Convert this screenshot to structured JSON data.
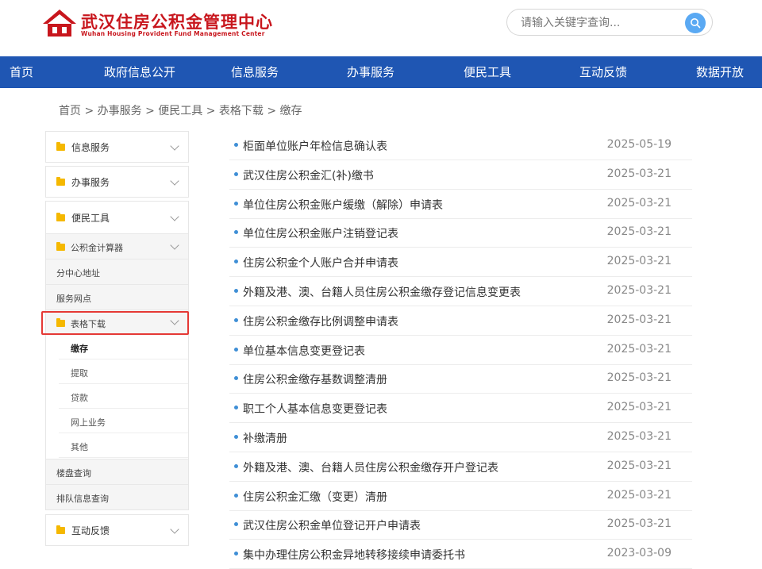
{
  "header": {
    "logo_cn": "武汉住房公积金管理中心",
    "logo_en": "Wuhan Housing Provident Fund Management Center",
    "search_placeholder": "请输入关键字查询...",
    "brand_color": "#c8161d"
  },
  "nav": {
    "color": "#1f56b3",
    "items": [
      "首页",
      "政府信息公开",
      "信息服务",
      "办事服务",
      "便民工具",
      "互动反馈",
      "数据开放"
    ]
  },
  "breadcrumb": "首页 > 办事服务 > 便民工具 > 表格下载 > 缴存",
  "sidebar": {
    "info": "信息服务",
    "service": "办事服务",
    "tools": "便民工具",
    "tools_sub": {
      "calculator": "公积金计算器",
      "branch": "分中心地址",
      "outlets": "服务网点",
      "forms": "表格下载",
      "forms_sub": [
        "缴存",
        "提取",
        "贷款",
        "网上业务",
        "其他"
      ],
      "property": "楼盘查询",
      "queue": "排队信息查询"
    },
    "feedback": "互动反馈"
  },
  "list": [
    {
      "title": "柜面单位账户年检信息确认表",
      "date": "2025-05-19"
    },
    {
      "title": "武汉住房公积金汇(补)缴书",
      "date": "2025-03-21"
    },
    {
      "title": "单位住房公积金账户缓缴（解除）申请表",
      "date": "2025-03-21"
    },
    {
      "title": "单位住房公积金账户注销登记表",
      "date": "2025-03-21"
    },
    {
      "title": "住房公积金个人账户合并申请表",
      "date": "2025-03-21"
    },
    {
      "title": "外籍及港、澳、台籍人员住房公积金缴存登记信息变更表",
      "date": "2025-03-21"
    },
    {
      "title": "住房公积金缴存比例调整申请表",
      "date": "2025-03-21"
    },
    {
      "title": "单位基本信息变更登记表",
      "date": "2025-03-21"
    },
    {
      "title": "住房公积金缴存基数调整清册",
      "date": "2025-03-21"
    },
    {
      "title": "职工个人基本信息变更登记表",
      "date": "2025-03-21"
    },
    {
      "title": "补缴清册",
      "date": "2025-03-21"
    },
    {
      "title": "外籍及港、澳、台籍人员住房公积金缴存开户登记表",
      "date": "2025-03-21"
    },
    {
      "title": "住房公积金汇缴（变更）清册",
      "date": "2025-03-21"
    },
    {
      "title": "武汉住房公积金单位登记开户申请表",
      "date": "2025-03-21"
    },
    {
      "title": "集中办理住房公积金异地转移接续申请委托书",
      "date": "2023-03-09"
    }
  ]
}
